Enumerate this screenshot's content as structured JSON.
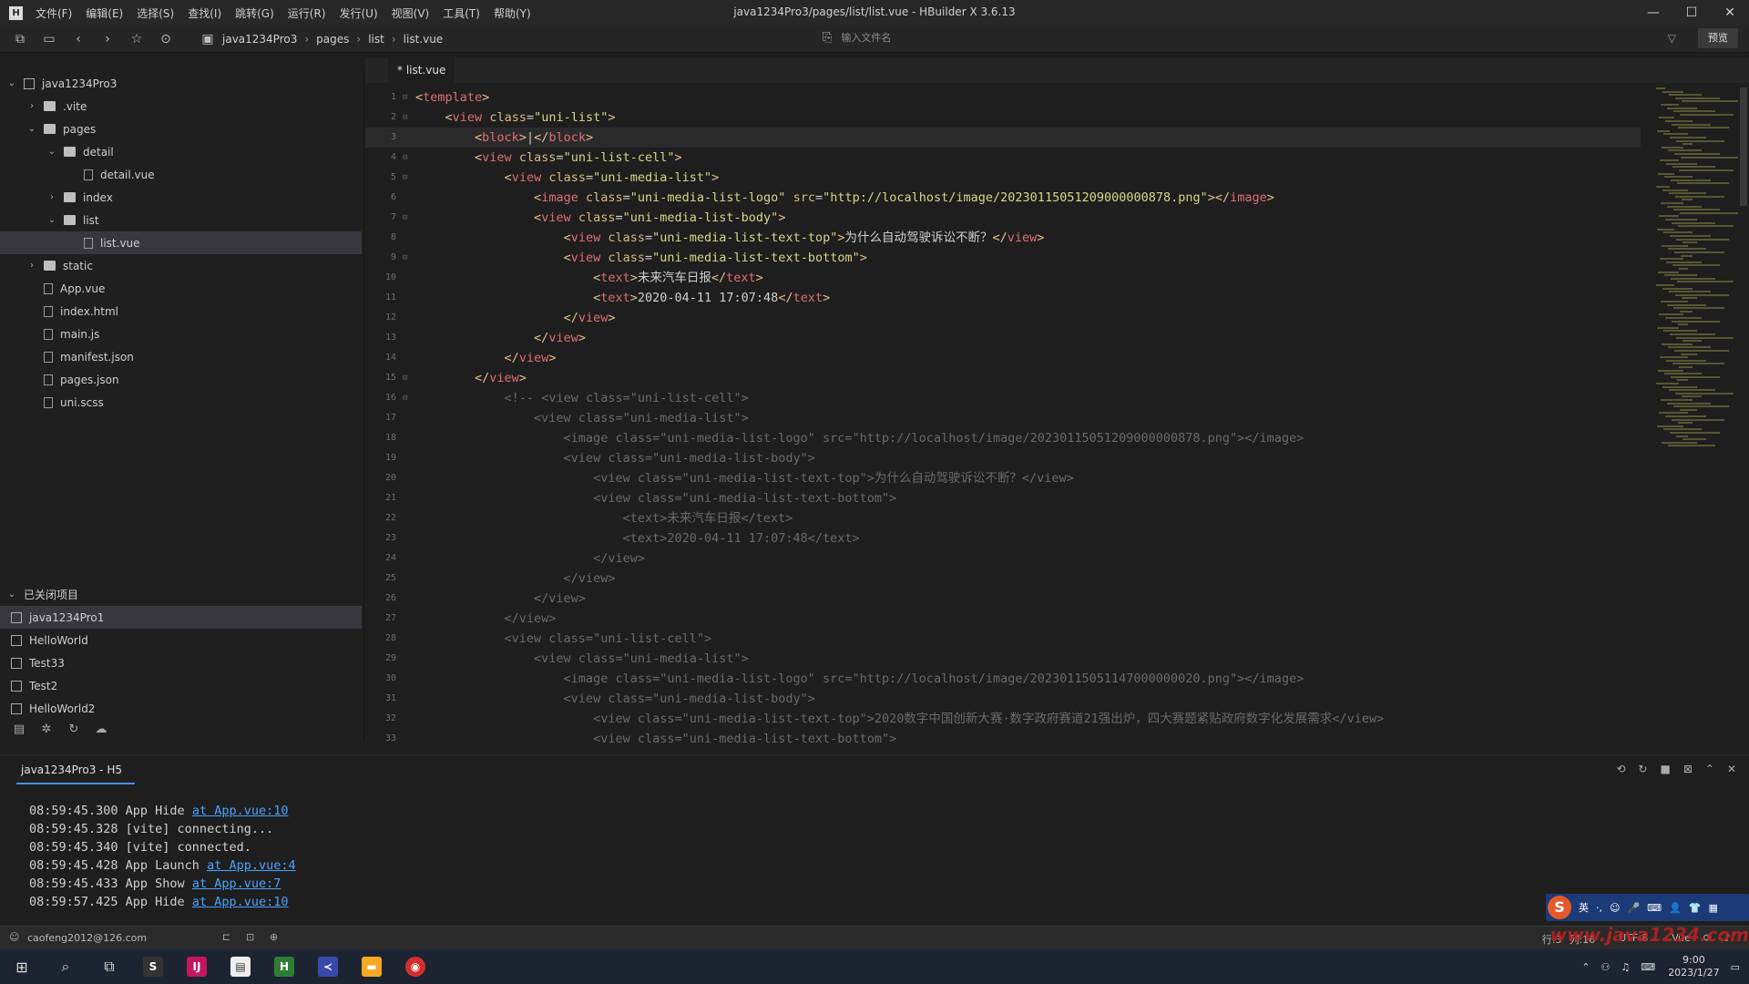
{
  "window": {
    "title": "java1234Pro3/pages/list/list.vue - HBuilder X 3.6.13",
    "logo_icon": "hbuilder-icon",
    "controls": [
      "—",
      "☐",
      "✕"
    ]
  },
  "menu": [
    "文件(F)",
    "编辑(E)",
    "选择(S)",
    "查找(I)",
    "跳转(G)",
    "运行(R)",
    "发行(U)",
    "视图(V)",
    "工具(T)",
    "帮助(Y)"
  ],
  "toolbar": {
    "breadcrumbs": [
      "java1234Pro3",
      "pages",
      "list",
      "list.vue"
    ],
    "search_placeholder": "输入文件名",
    "preview_label": "预览"
  },
  "sidebar": {
    "tree": [
      {
        "label": "java1234Pro3",
        "indent": 0,
        "arrow": "⌄",
        "type": "project"
      },
      {
        "label": ".vite",
        "indent": 1,
        "arrow": "›",
        "type": "folder"
      },
      {
        "label": "pages",
        "indent": 1,
        "arrow": "⌄",
        "type": "folder"
      },
      {
        "label": "detail",
        "indent": 2,
        "arrow": "⌄",
        "type": "folder"
      },
      {
        "label": "detail.vue",
        "indent": 3,
        "arrow": "",
        "type": "file"
      },
      {
        "label": "index",
        "indent": 2,
        "arrow": "›",
        "type": "folder"
      },
      {
        "label": "list",
        "indent": 2,
        "arrow": "⌄",
        "type": "folder"
      },
      {
        "label": "list.vue",
        "indent": 3,
        "arrow": "",
        "type": "file",
        "selected": true
      },
      {
        "label": "static",
        "indent": 1,
        "arrow": "›",
        "type": "folder"
      },
      {
        "label": "App.vue",
        "indent": 1,
        "arrow": "",
        "type": "file"
      },
      {
        "label": "index.html",
        "indent": 1,
        "arrow": "",
        "type": "html"
      },
      {
        "label": "main.js",
        "indent": 1,
        "arrow": "",
        "type": "file"
      },
      {
        "label": "manifest.json",
        "indent": 1,
        "arrow": "",
        "type": "file"
      },
      {
        "label": "pages.json",
        "indent": 1,
        "arrow": "",
        "type": "json"
      },
      {
        "label": "uni.scss",
        "indent": 1,
        "arrow": "",
        "type": "scss"
      }
    ],
    "closed_header": "已关闭项目",
    "closed_projects": [
      "java1234Pro1",
      "HelloWorld",
      "Test33",
      "Test2",
      "HelloWorld2"
    ]
  },
  "editor": {
    "tab_label": "* list.vue",
    "lines": [
      {
        "n": "1",
        "f": "⊟",
        "html": "<span class='tg'>&lt;</span><span class='tn'>template</span><span class='tg'>&gt;</span>"
      },
      {
        "n": "2",
        "f": "⊟",
        "html": "    <span class='tg'>&lt;</span><span class='tn'>view</span> <span class='at'>class</span>=<span class='st'>\"uni-list\"</span><span class='tg'>&gt;</span>"
      },
      {
        "n": "3",
        "f": "",
        "cur": true,
        "html": "        <span class='tg'>&lt;</span><span class='tn'>block</span><span class='tg'>&gt;</span>|<span class='tg'>&lt;/</span><span class='tn'>block</span><span class='tg'>&gt;</span>"
      },
      {
        "n": "4",
        "f": "⊟",
        "html": "        <span class='tg'>&lt;</span><span class='tn'>view</span> <span class='at'>class</span>=<span class='st'>\"uni-list-cell\"</span><span class='tg'>&gt;</span>"
      },
      {
        "n": "5",
        "f": "⊟",
        "html": "            <span class='tg'>&lt;</span><span class='tn'>view</span> <span class='at'>class</span>=<span class='st'>\"uni-media-list\"</span><span class='tg'>&gt;</span>"
      },
      {
        "n": "6",
        "f": "",
        "html": "                <span class='tg'>&lt;</span><span class='tn'>image</span> <span class='at'>class</span>=<span class='st'>\"uni-media-list-logo\"</span> <span class='at'>src</span>=<span class='st'>\"http://localhost/image/20230115051209000000878.png\"</span><span class='tg'>&gt;&lt;/</span><span class='tn'>image</span><span class='tg'>&gt;</span>"
      },
      {
        "n": "7",
        "f": "⊟",
        "html": "                <span class='tg'>&lt;</span><span class='tn'>view</span> <span class='at'>class</span>=<span class='st'>\"uni-media-list-body\"</span><span class='tg'>&gt;</span>"
      },
      {
        "n": "8",
        "f": "",
        "html": "                    <span class='tg'>&lt;</span><span class='tn'>view</span> <span class='at'>class</span>=<span class='st'>\"uni-media-list-text-top\"</span><span class='tg'>&gt;</span>为什么自动驾驶诉讼不断？<span class='tg'>&lt;/</span><span class='tn'>view</span><span class='tg'>&gt;</span>"
      },
      {
        "n": "9",
        "f": "⊟",
        "html": "                    <span class='tg'>&lt;</span><span class='tn'>view</span> <span class='at'>class</span>=<span class='st'>\"uni-media-list-text-bottom\"</span><span class='tg'>&gt;</span>"
      },
      {
        "n": "10",
        "f": "",
        "html": "                        <span class='tg'>&lt;</span><span class='tn'>text</span><span class='tg'>&gt;</span>未来汽车日报<span class='tg'>&lt;/</span><span class='tn'>text</span><span class='tg'>&gt;</span>"
      },
      {
        "n": "11",
        "f": "",
        "html": "                        <span class='tg'>&lt;</span><span class='tn'>text</span><span class='tg'>&gt;</span>2020-04-11 17:07:48<span class='tg'>&lt;/</span><span class='tn'>text</span><span class='tg'>&gt;</span>"
      },
      {
        "n": "12",
        "f": "",
        "html": "                    <span class='tg'>&lt;/</span><span class='tn'>view</span><span class='tg'>&gt;</span>"
      },
      {
        "n": "13",
        "f": "",
        "html": "                <span class='tg'>&lt;/</span><span class='tn'>view</span><span class='tg'>&gt;</span>"
      },
      {
        "n": "14",
        "f": "",
        "html": "            <span class='tg'>&lt;/</span><span class='tn'>view</span><span class='tg'>&gt;</span>"
      },
      {
        "n": "15",
        "f": "⊟",
        "html": "        <span class='tg'>&lt;/</span><span class='tn'>view</span><span class='tg'>&gt;</span>"
      },
      {
        "n": "16",
        "f": "⊟",
        "html": "            <span class='cm'>&lt;!-- &lt;view class=\"uni-list-cell\"&gt;</span>"
      },
      {
        "n": "17",
        "f": "",
        "html": "<span class='cm'>                &lt;view class=\"uni-media-list\"&gt;</span>"
      },
      {
        "n": "18",
        "f": "",
        "html": "<span class='cm'>                    &lt;image class=\"uni-media-list-logo\" src=\"http://localhost/image/20230115051209000000878.png\"&gt;&lt;/image&gt;</span>"
      },
      {
        "n": "19",
        "f": "",
        "html": "<span class='cm'>                    &lt;view class=\"uni-media-list-body\"&gt;</span>"
      },
      {
        "n": "20",
        "f": "",
        "html": "<span class='cm'>                        &lt;view class=\"uni-media-list-text-top\"&gt;为什么自动驾驶诉讼不断？&lt;/view&gt;</span>"
      },
      {
        "n": "21",
        "f": "",
        "html": "<span class='cm'>                        &lt;view class=\"uni-media-list-text-bottom\"&gt;</span>"
      },
      {
        "n": "22",
        "f": "",
        "html": "<span class='cm'>                            &lt;text&gt;未来汽车日报&lt;/text&gt;</span>"
      },
      {
        "n": "23",
        "f": "",
        "html": "<span class='cm'>                            &lt;text&gt;2020-04-11 17:07:48&lt;/text&gt;</span>"
      },
      {
        "n": "24",
        "f": "",
        "html": "<span class='cm'>                        &lt;/view&gt;</span>"
      },
      {
        "n": "25",
        "f": "",
        "html": "<span class='cm'>                    &lt;/view&gt;</span>"
      },
      {
        "n": "26",
        "f": "",
        "html": "<span class='cm'>                &lt;/view&gt;</span>"
      },
      {
        "n": "27",
        "f": "",
        "html": "<span class='cm'>            &lt;/view&gt;</span>"
      },
      {
        "n": "28",
        "f": "",
        "html": "<span class='cm'>            &lt;view class=\"uni-list-cell\"&gt;</span>"
      },
      {
        "n": "29",
        "f": "",
        "html": "<span class='cm'>                &lt;view class=\"uni-media-list\"&gt;</span>"
      },
      {
        "n": "30",
        "f": "",
        "html": "<span class='cm'>                    &lt;image class=\"uni-media-list-logo\" src=\"http://localhost/image/20230115051147000000020.png\"&gt;&lt;/image&gt;</span>"
      },
      {
        "n": "31",
        "f": "",
        "html": "<span class='cm'>                    &lt;view class=\"uni-media-list-body\"&gt;</span>"
      },
      {
        "n": "32",
        "f": "",
        "html": "<span class='cm'>                        &lt;view class=\"uni-media-list-text-top\"&gt;2020数字中国创新大赛·数字政府赛道21强出炉，四大赛题紧贴政府数字化发展需求&lt;/view&gt;</span>"
      },
      {
        "n": "33",
        "f": "",
        "html": "<span class='cm'>                        &lt;view class=\"uni-media-list-text-bottom\"&gt;</span>"
      }
    ]
  },
  "console": {
    "tab_label": "java1234Pro3 - H5",
    "logs": [
      {
        "text": "08:59:45.300 App Hide ",
        "link": "at App.vue:10"
      },
      {
        "text": "08:59:45.328 [vite] connecting...",
        "link": ""
      },
      {
        "text": "08:59:45.340 [vite] connected.",
        "link": ""
      },
      {
        "text": "08:59:45.428 App Launch ",
        "link": "at App.vue:4"
      },
      {
        "text": "08:59:45.433 App Show ",
        "link": "at App.vue:7"
      },
      {
        "text": "08:59:57.425 App Hide ",
        "link": "at App.vue:10"
      }
    ]
  },
  "ime": {
    "logo": "S",
    "items": [
      "英",
      "·,",
      "☺",
      "🎤",
      "⌨",
      "👤",
      "👕",
      "▦"
    ]
  },
  "statusbar": {
    "account": "caofeng2012@126.com",
    "row": "行:3",
    "col": "列:16",
    "encoding": "UTF-8",
    "language": "Vue"
  },
  "taskbar": {
    "date": "2023/1/27",
    "time": "9:00"
  },
  "watermark": "www.java1234.com"
}
